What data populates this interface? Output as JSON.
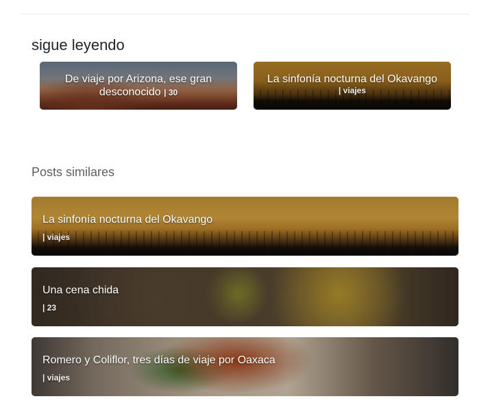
{
  "section": {
    "heading": "sigue leyendo"
  },
  "continue_reading": [
    {
      "title": "De viaje por Arizona, ese gran desconocido",
      "meta": "| 30"
    },
    {
      "title": "La sinfonía nocturna del Okavango",
      "meta": "| viajes"
    }
  ],
  "similar": {
    "heading": "Posts similares",
    "posts": [
      {
        "title": "La sinfonía nocturna del Okavango",
        "meta": "| viajes"
      },
      {
        "title": "Una cena chida",
        "meta": "| 23"
      },
      {
        "title": "Romero y Coliflor, tres días de viaje por Oaxaca",
        "meta": "| viajes"
      }
    ]
  }
}
